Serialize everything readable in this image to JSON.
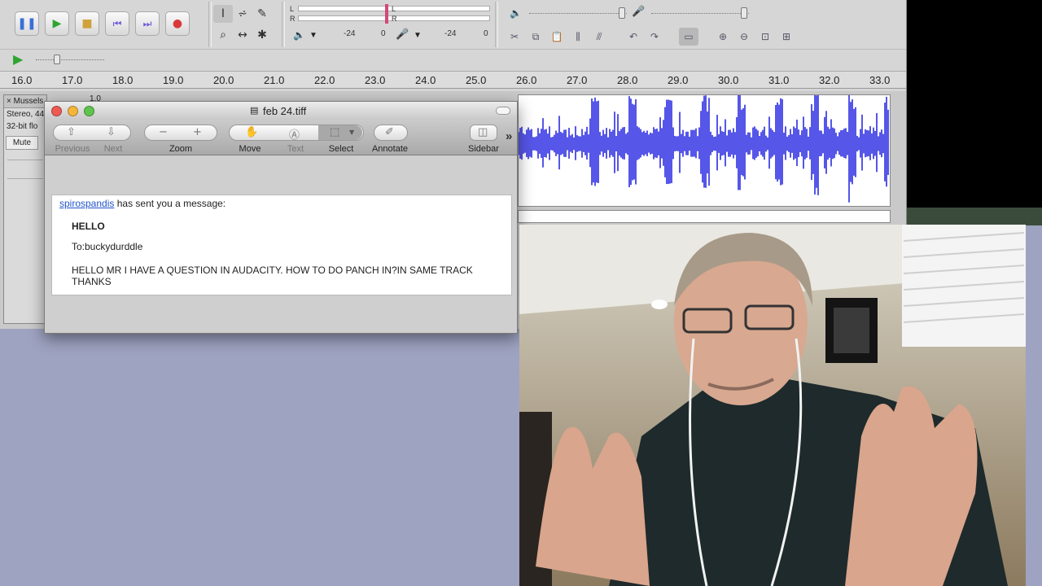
{
  "audacity": {
    "meter_left_labels": [
      "L",
      "R"
    ],
    "meter_right_labels": [
      "L",
      "R"
    ],
    "db_marks": [
      "-24",
      "0",
      "-24",
      "0"
    ],
    "ruler_ticks": [
      "16.0",
      "17.0",
      "18.0",
      "19.0",
      "20.0",
      "21.0",
      "22.0",
      "23.0",
      "24.0",
      "25.0",
      "26.0",
      "27.0",
      "28.0",
      "29.0",
      "30.0",
      "31.0",
      "32.0",
      "33.0"
    ],
    "track": {
      "name": "Mussels MP",
      "info_line1": "Stereo, 44",
      "info_line2": "32-bit flo",
      "mute_label": "Mute",
      "gain_label": "1.0"
    },
    "colors": {
      "waveform": "#5656e8",
      "background": "#d6d6d6"
    }
  },
  "preview": {
    "title": "feb 24.tiff",
    "toolbar": {
      "previous": "Previous",
      "next": "Next",
      "zoom": "Zoom",
      "move": "Move",
      "text": "Text",
      "select": "Select",
      "annotate": "Annotate",
      "sidebar": "Sidebar",
      "overflow": "»"
    },
    "message": {
      "sender": "spirospandis",
      "sender_suffix": "has sent you a message:",
      "subject": "HELLO",
      "to": "To:buckydurddle",
      "body_line1": "HELLO MR I HAVE A QUESTION IN AUDACITY. HOW TO DO PANCH IN?IN SAME TRACK",
      "body_line2": "THANKS"
    }
  }
}
